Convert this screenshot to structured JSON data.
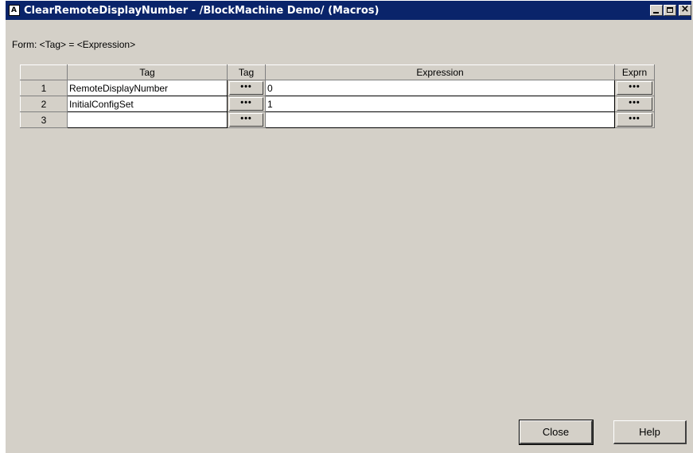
{
  "window": {
    "title": "ClearRemoteDisplayNumber - /BlockMachine Demo/ (Macros)",
    "icon": "macro-app-icon"
  },
  "form_label": "Form: <Tag> = <Expression>",
  "grid": {
    "headers": {
      "tag": "Tag",
      "tag_btn": "Tag",
      "expression": "Expression",
      "exprn_btn": "Exprn"
    },
    "browse_label": "•••",
    "rows": [
      {
        "num": "1",
        "tag": "RemoteDisplayNumber",
        "expression": "0"
      },
      {
        "num": "2",
        "tag": "InitialConfigSet",
        "expression": "1"
      },
      {
        "num": "3",
        "tag": "",
        "expression": ""
      }
    ]
  },
  "buttons": {
    "close": "Close",
    "help": "Help"
  },
  "colors": {
    "titlebar": "#0a246a",
    "face": "#d4d0c8"
  }
}
